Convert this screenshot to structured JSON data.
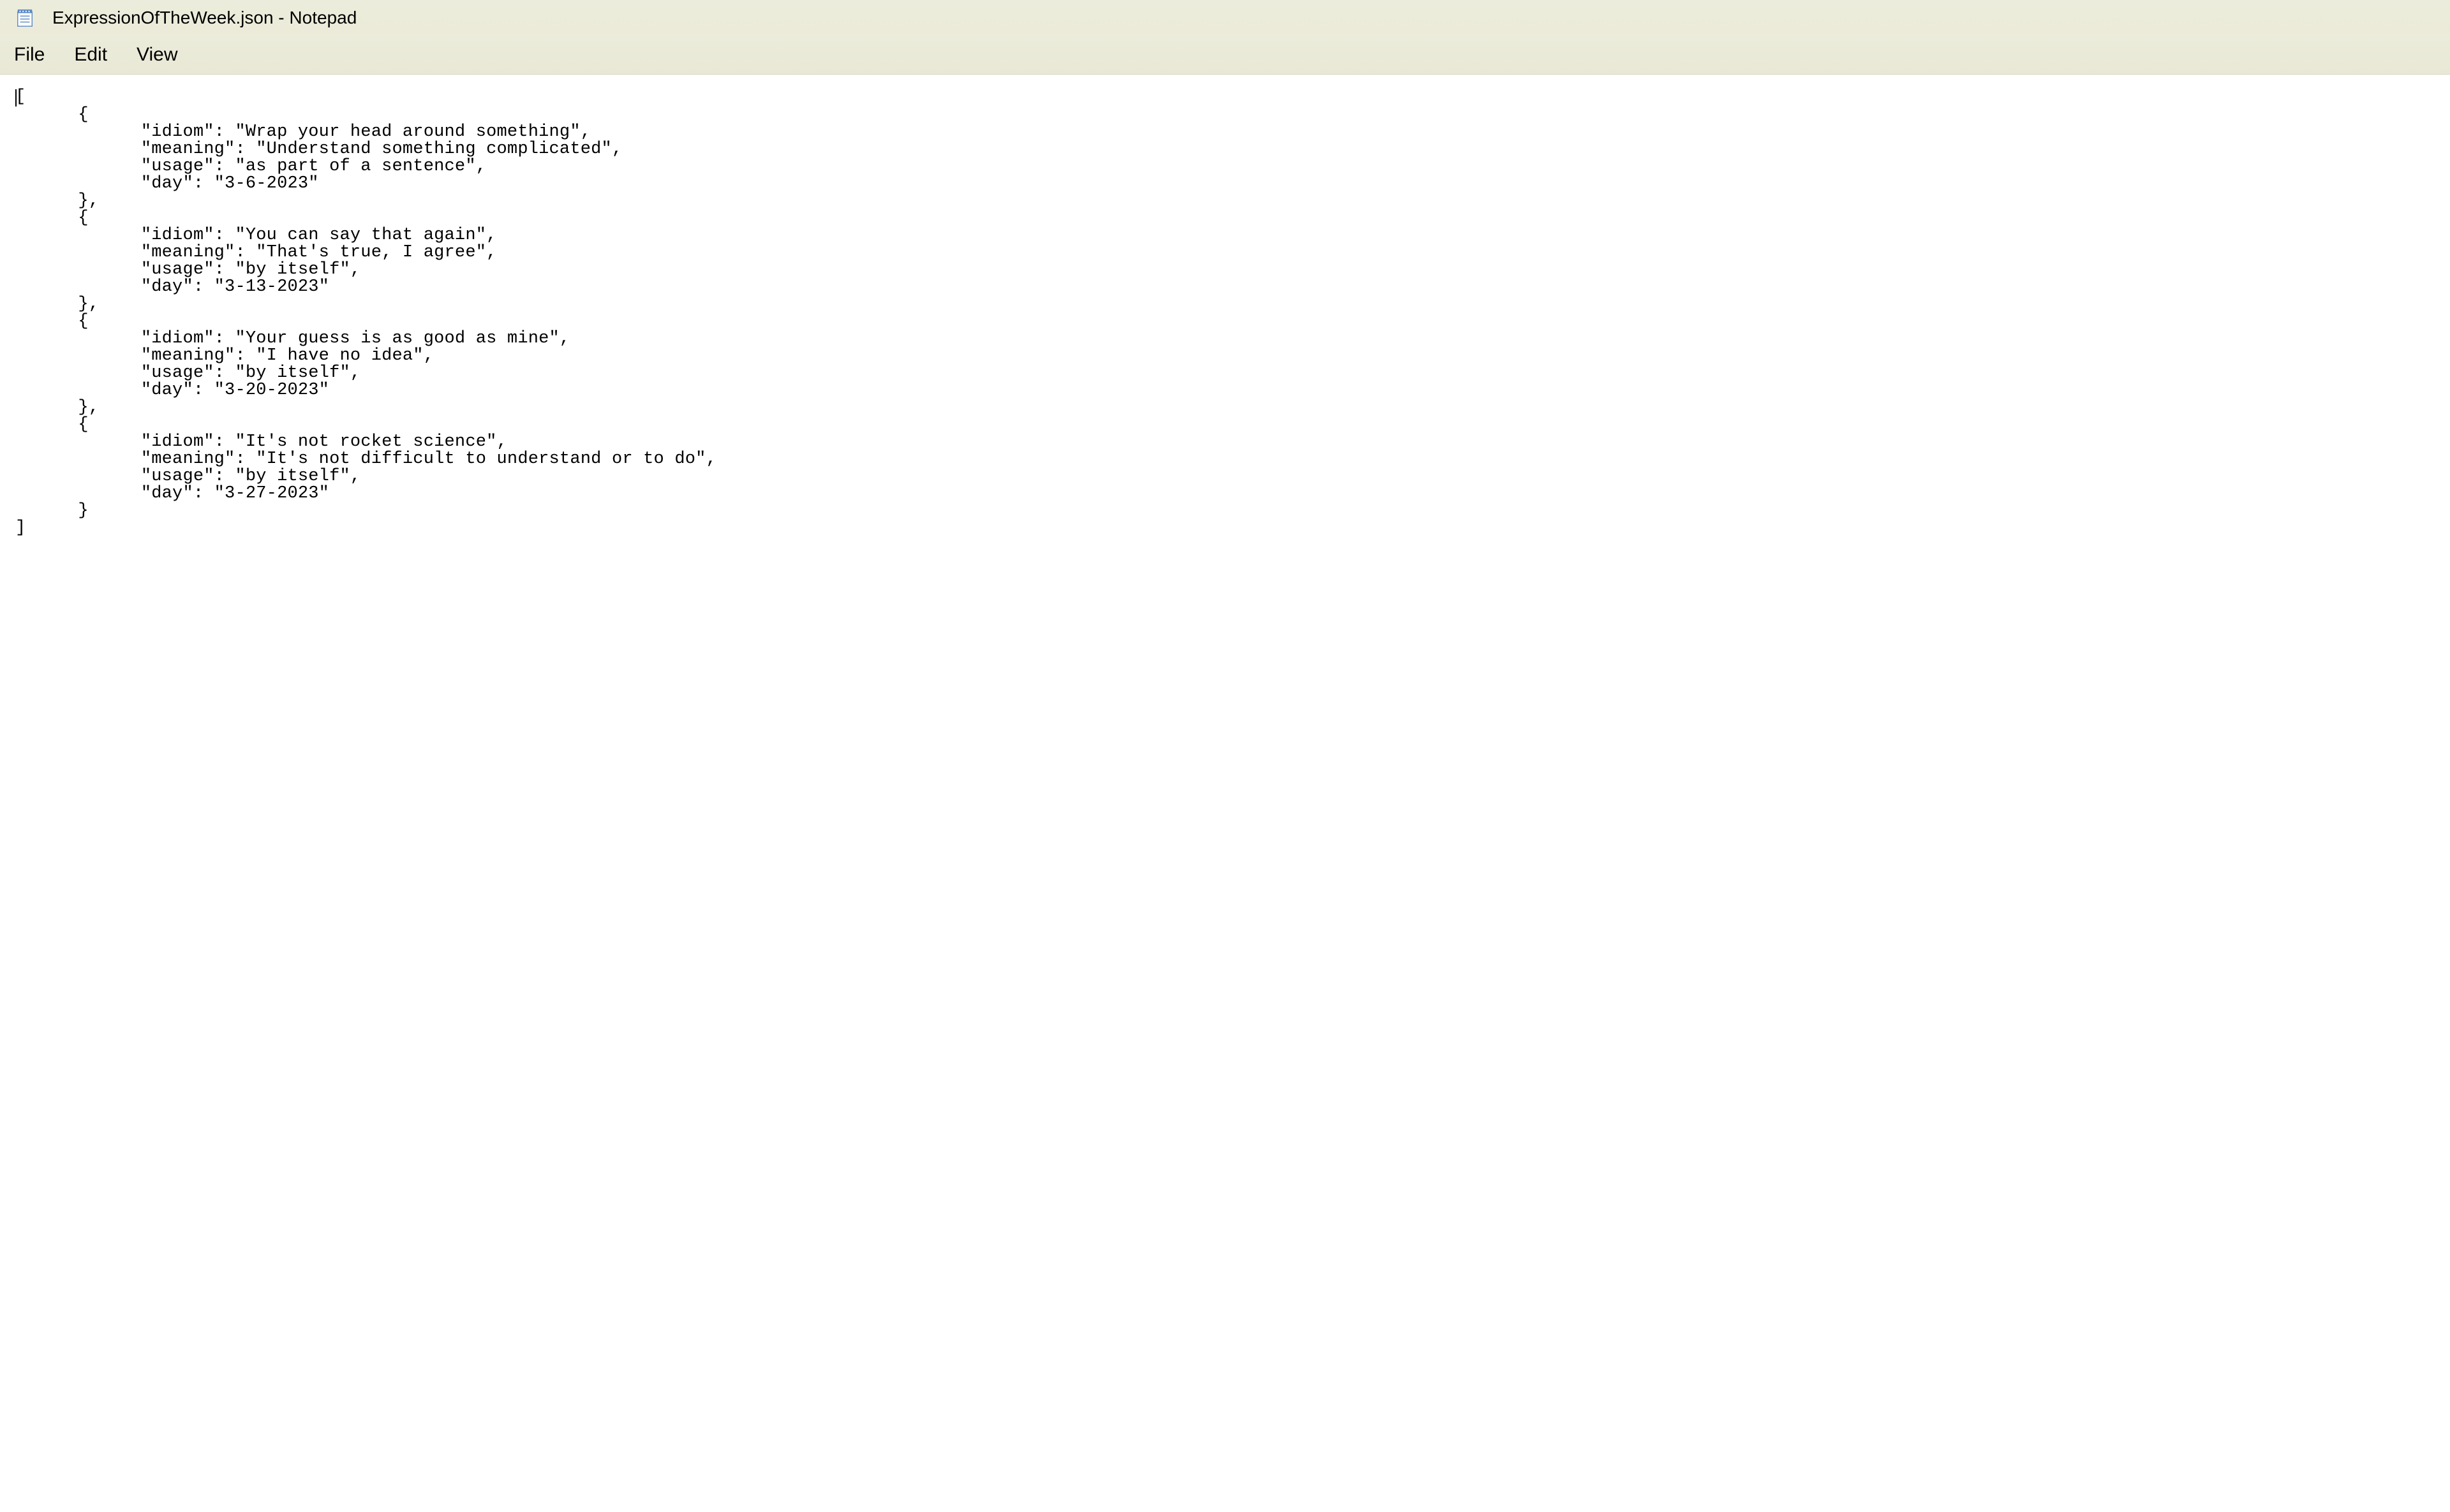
{
  "titlebar": {
    "title": "ExpressionOfTheWeek.json - Notepad"
  },
  "menu": {
    "file": "File",
    "edit": "Edit",
    "view": "View"
  },
  "editor": {
    "content": "[\n      {\n            \"idiom\": \"Wrap your head around something\",\n            \"meaning\": \"Understand something complicated\",\n            \"usage\": \"as part of a sentence\",\n            \"day\": \"3-6-2023\"\n      },\n      {\n            \"idiom\": \"You can say that again\",\n            \"meaning\": \"That's true, I agree\",\n            \"usage\": \"by itself\",\n            \"day\": \"3-13-2023\"\n      },\n      {\n            \"idiom\": \"Your guess is as good as mine\",\n            \"meaning\": \"I have no idea\",\n            \"usage\": \"by itself\",\n            \"day\": \"3-20-2023\"\n      },\n      {\n            \"idiom\": \"It's not rocket science\",\n            \"meaning\": \"It's not difficult to understand or to do\",\n            \"usage\": \"by itself\",\n            \"day\": \"3-27-2023\"\n      }\n]"
  }
}
